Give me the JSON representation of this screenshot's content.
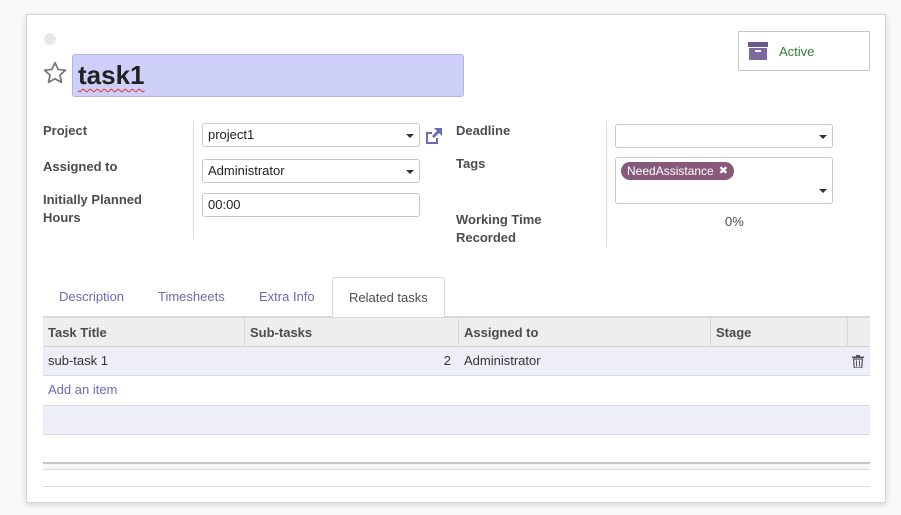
{
  "task": {
    "title": "task1",
    "status_button_label": "Active"
  },
  "fields": {
    "project": {
      "label": "Project",
      "value": "project1"
    },
    "assigned_to": {
      "label": "Assigned to",
      "value": "Administrator"
    },
    "planned_hours": {
      "label_line1": "Initially Planned",
      "label_line2": "Hours",
      "value": "00:00"
    },
    "deadline": {
      "label": "Deadline",
      "value": ""
    },
    "tags": {
      "label": "Tags",
      "items": [
        "NeedAssistance"
      ]
    },
    "working_time": {
      "label_line1": "Working Time",
      "label_line2": "Recorded",
      "value": "0%"
    }
  },
  "tabs": [
    "Description",
    "Timesheets",
    "Extra Info",
    "Related tasks"
  ],
  "active_tab": "Related tasks",
  "table": {
    "columns": [
      "Task Title",
      "Sub-tasks",
      "Assigned to",
      "Stage"
    ],
    "rows": [
      {
        "title": "sub-task 1",
        "subtasks": "2",
        "assigned": "Administrator",
        "stage": ""
      }
    ],
    "add_item_label": "Add an item"
  },
  "colors": {
    "accent": "#6a6ab5",
    "tag": "#875a7b",
    "title_highlight": "#cfd0fa",
    "active_text": "#2e7d32"
  },
  "icons": {
    "favorite": "star-outline-icon",
    "archive": "archive-box-icon",
    "external_link": "external-link-icon",
    "delete": "trash-icon",
    "dropdown": "caret-down-icon"
  }
}
